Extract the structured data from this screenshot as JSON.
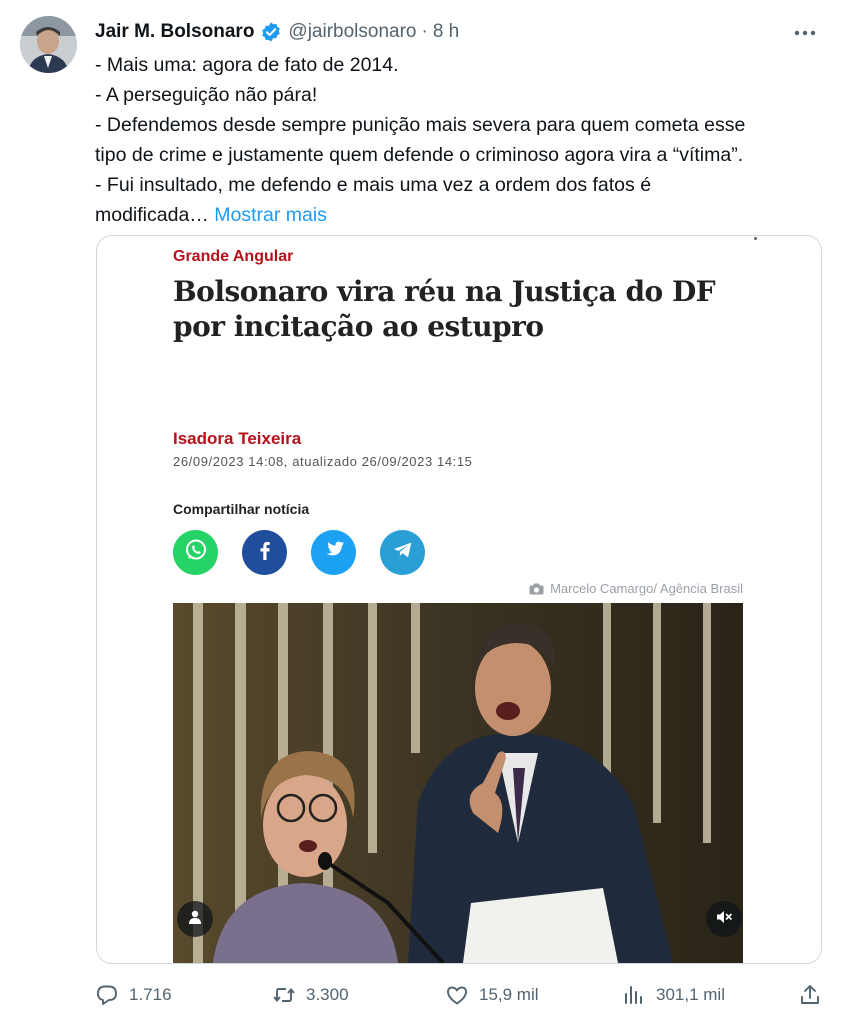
{
  "tweet": {
    "display_name": "Jair M. Bolsonaro",
    "verified": true,
    "handle": "@jairbolsonaro",
    "separator": "·",
    "time": "8 h",
    "more_icon": "more-horizontal-icon",
    "text_lines": [
      "- Mais uma: agora de fato de 2014.",
      "- A perseguição não pára!",
      "- Defendemos desde sempre punição mais severa para quem cometa esse",
      "tipo de crime e justamente quem defende o criminoso agora vira a “vítima”.",
      "- Fui insultado, me defendo e mais uma vez a ordem dos fatos é",
      "modificada…"
    ],
    "show_more": "Mostrar mais"
  },
  "card": {
    "kicker": "Grande Angular",
    "headline": "Bolsonaro vira réu na Justiça do DF por incitação ao estupro",
    "author": "Isadora Teixeira",
    "dateline": "26/09/2023 14:08, atualizado 26/09/2023 14:15",
    "share_label": "Compartilhar notícia",
    "share_buttons": [
      {
        "name": "whatsapp",
        "icon": "whatsapp-icon",
        "color": "#25d366"
      },
      {
        "name": "facebook",
        "icon": "facebook-icon",
        "color": "#1f4e9c"
      },
      {
        "name": "twitter",
        "icon": "twitter-bird-icon",
        "color": "#1da1f2"
      },
      {
        "name": "telegram",
        "icon": "telegram-icon",
        "color": "#2a9fd6"
      }
    ],
    "photo_credit": "Marcelo Camargo/ Agência Brasil"
  },
  "actions": {
    "replies": "1.716",
    "retweets": "3.300",
    "likes": "15,9 mil",
    "views": "301,1 mil"
  },
  "colors": {
    "text": "#0f1419",
    "secondary": "#536471",
    "link": "#1d9bf0",
    "verified": "#1d9bf0",
    "kicker_red": "#b5121b"
  }
}
